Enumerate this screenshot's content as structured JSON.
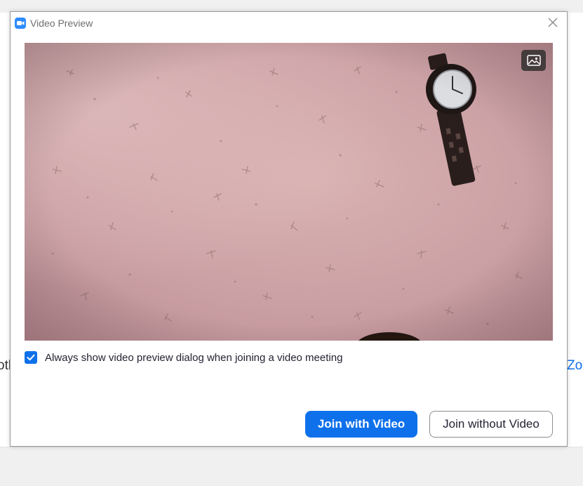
{
  "background_app": {
    "left_text": "oth",
    "right_text": "Zo"
  },
  "dialog": {
    "title": "Video Preview",
    "app_icon": "zoom-camera-icon",
    "close_icon": "close-icon",
    "video": {
      "background_toggle_icon": "image-icon"
    },
    "preview_checkbox": {
      "checked": true,
      "label": "Always show video preview dialog when joining a video meeting"
    },
    "buttons": {
      "join_with_video": "Join with Video",
      "join_without_video": "Join without Video"
    }
  },
  "colors": {
    "accent": "#0e71eb",
    "title_text": "#6e6e6e",
    "body_text": "#232333"
  }
}
